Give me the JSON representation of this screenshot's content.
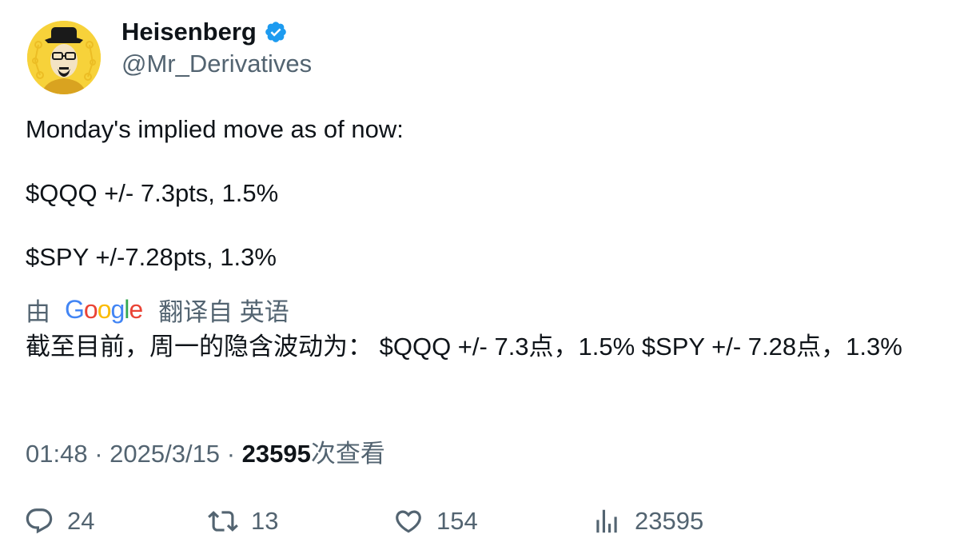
{
  "author": {
    "display_name": "Heisenberg",
    "handle": "@Mr_Derivatives",
    "verified": true
  },
  "tweet": {
    "lines": [
      "Monday's implied move as of now:",
      "",
      "$QQQ +/- 7.3pts, 1.5%",
      "",
      "$SPY +/-7.28pts, 1.3%"
    ]
  },
  "translation": {
    "by_label": "由",
    "google_letters": [
      "G",
      "o",
      "o",
      "g",
      "l",
      "e"
    ],
    "from_label": "翻译自 英语",
    "text": "截至目前，周一的隐含波动为： $QQQ +/- 7.3点，1.5% $SPY +/- 7.28点，1.3%"
  },
  "meta": {
    "time": "01:48",
    "separator": "·",
    "date": "2025/3/15",
    "views_count": "23595",
    "views_label": "次查看"
  },
  "actions": {
    "replies": "24",
    "retweets": "13",
    "likes": "154",
    "views": "23595"
  },
  "colors": {
    "text": "#0f1419",
    "secondary": "#536471",
    "verified_blue": "#1d9bf0",
    "avatar_bg": "#f7d23a"
  },
  "icons": [
    "verified-badge-icon",
    "reply-icon",
    "retweet-icon",
    "like-icon",
    "views-chart-icon"
  ]
}
